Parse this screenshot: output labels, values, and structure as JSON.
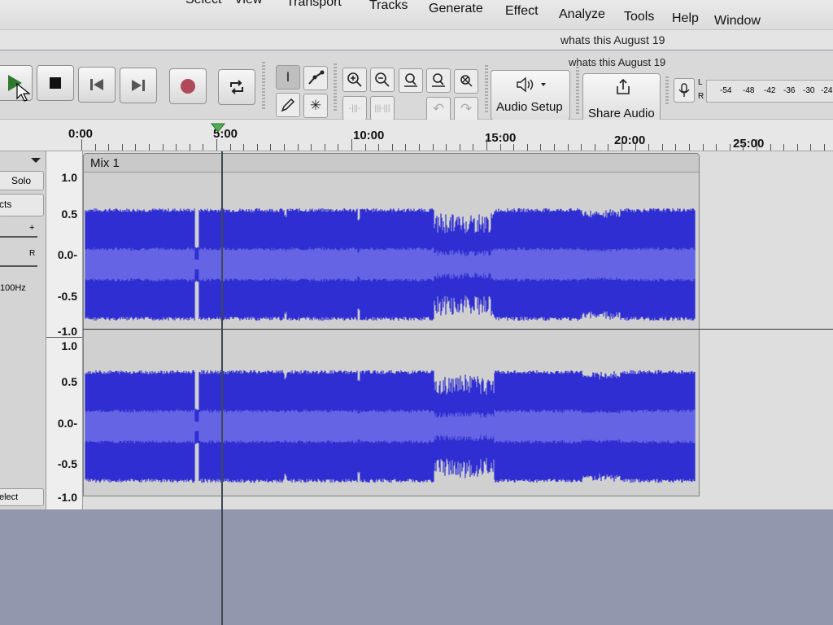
{
  "menu": [
    "Select",
    "View",
    "Transport",
    "Tracks",
    "Generate",
    "Effect",
    "Analyze",
    "Tools",
    "Help",
    "Window"
  ],
  "window_title": "whats this August 19",
  "toolbar_title": "whats this August 19",
  "toolbar": {
    "audio_setup_label": "Audio Setup",
    "share_audio_label": "Share Audio",
    "meter_l": "L",
    "meter_r": "R",
    "meter_ticks": [
      "-54",
      "-48",
      "-42",
      "-36",
      "-30",
      "-24"
    ]
  },
  "ruler": {
    "labels": [
      "0:00",
      "5:00",
      "10:00",
      "15:00",
      "20:00",
      "25:00"
    ]
  },
  "track": {
    "name": "Mix 1",
    "solo_label": "Solo",
    "effects_label": "cts",
    "gain_plus": "+",
    "pan_r": "R",
    "rate_label": "100Hz",
    "select_label": "elect",
    "scale_top": [
      "1.0",
      "0.5",
      "0.0-",
      "-0.5",
      "-1.0"
    ],
    "scale_bottom": [
      "1.0",
      "0.5",
      "0.0-",
      "-0.5",
      "-1.0"
    ]
  },
  "colors": {
    "waveform_peak": "#2f2fd2",
    "waveform_rms": "#6a6ae6",
    "track_bg": "#d0d0d0",
    "play_green": "#2f7a2f",
    "record_red": "#b04a5a"
  }
}
